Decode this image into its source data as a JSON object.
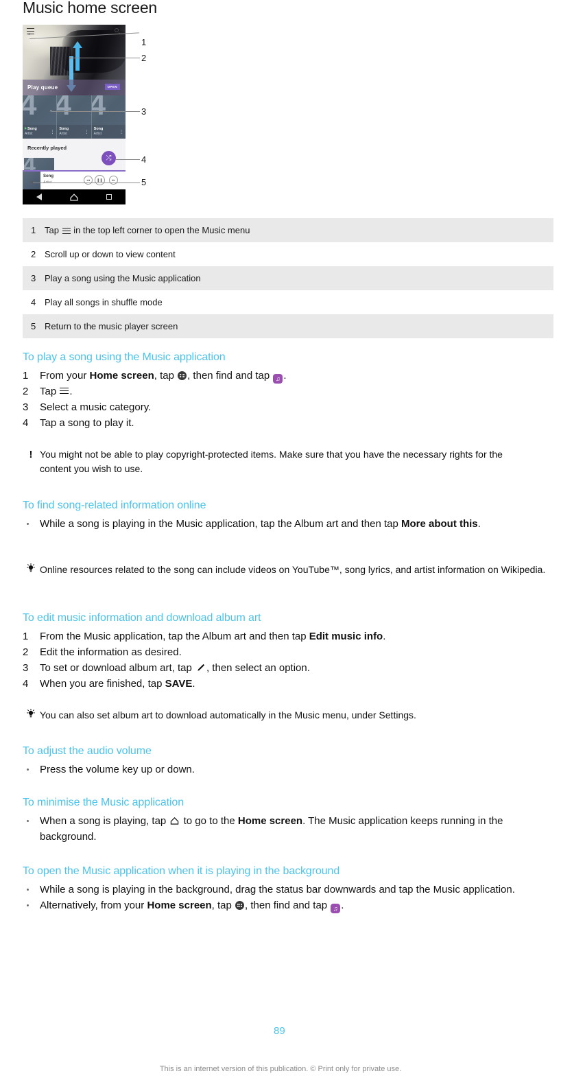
{
  "title": "Music home screen",
  "figure": {
    "phone": {
      "play_queue_label": "Play queue",
      "open_button": "OPEN",
      "recently_played_label": "Recently played",
      "tiles": [
        {
          "song": "Song",
          "artist": "Artist"
        },
        {
          "song": "Song",
          "artist": "Artist"
        },
        {
          "song": "Song",
          "artist": "Artist"
        }
      ],
      "mini_player": {
        "song": "Song",
        "artist": "Artist"
      },
      "icons": {
        "menu": "hamburger-icon",
        "search": "search-icon",
        "shuffle": "shuffle-icon",
        "previous": "previous-icon",
        "pause": "pause-icon",
        "next": "next-icon",
        "nav_back": "back-icon",
        "nav_home": "home-icon",
        "nav_recents": "recents-icon"
      }
    },
    "callouts": [
      "1",
      "2",
      "3",
      "4",
      "5"
    ]
  },
  "legend": {
    "rows": [
      {
        "num": "1",
        "pre": "Tap ",
        "post": " in the top left corner to open the Music menu",
        "icon": "hamburger-icon"
      },
      {
        "num": "2",
        "text": "Scroll up or down to view content"
      },
      {
        "num": "3",
        "text": "Play a song using the Music application"
      },
      {
        "num": "4",
        "text": "Play all songs in shuffle mode"
      },
      {
        "num": "5",
        "text": "Return to the music player screen"
      }
    ]
  },
  "sections": {
    "play_song": {
      "heading": "To play a song using the Music application",
      "steps": [
        {
          "n": "1",
          "a": "From your ",
          "b": "Home screen",
          "c": ", tap ",
          "d": ", then find and tap ",
          "e": "."
        },
        {
          "n": "2",
          "a": "Tap ",
          "e": "."
        },
        {
          "n": "3",
          "a": "Select a music category."
        },
        {
          "n": "4",
          "a": "Tap a song to play it."
        }
      ],
      "note": "You might not be able to play copyright-protected items. Make sure that you have the necessary rights for the content you wish to use."
    },
    "find_info": {
      "heading": "To find song-related information online",
      "bullet_a": "While a song is playing in the Music application, tap the Album art and then tap ",
      "bullet_b": "More about this",
      "bullet_c": ".",
      "tip": "Online resources related to the song can include videos on YouTube™, song lyrics, and artist information on Wikipedia."
    },
    "edit_info": {
      "heading": "To edit music information and download album art",
      "steps": [
        {
          "n": "1",
          "a": "From the Music application, tap the Album art and then tap ",
          "b": "Edit music info",
          "c": "."
        },
        {
          "n": "2",
          "a": "Edit the information as desired."
        },
        {
          "n": "3",
          "a": "To set or download album art, tap ",
          "c": ", then select an option."
        },
        {
          "n": "4",
          "a": "When you are finished, tap ",
          "b": "SAVE",
          "c": "."
        }
      ],
      "tip": "You can also set album art to download automatically in the Music menu, under Settings."
    },
    "volume": {
      "heading": "To adjust the audio volume",
      "bullet": "Press the volume key up or down."
    },
    "minimise": {
      "heading": "To minimise the Music application",
      "bullet_a": "When a song is playing, tap ",
      "bullet_b": " to go to the ",
      "bullet_c": "Home screen",
      "bullet_d": ". The Music application keeps running in the background."
    },
    "open_background": {
      "heading": "To open the Music application when it is playing in the background",
      "bullet_1": "While a song is playing in the background, drag the status bar downwards and tap the Music application.",
      "bullet_2a": "Alternatively, from your ",
      "bullet_2b": "Home screen",
      "bullet_2c": ", tap ",
      "bullet_2d": ", then find and tap ",
      "bullet_2e": "."
    }
  },
  "footer": {
    "page_number": "89",
    "note": "This is an internet version of this publication. © Print only for private use."
  },
  "colors": {
    "heading": "#4bc3ea",
    "row_shade": "#e9e9e9",
    "accent_purple": "#7c4fbd"
  }
}
